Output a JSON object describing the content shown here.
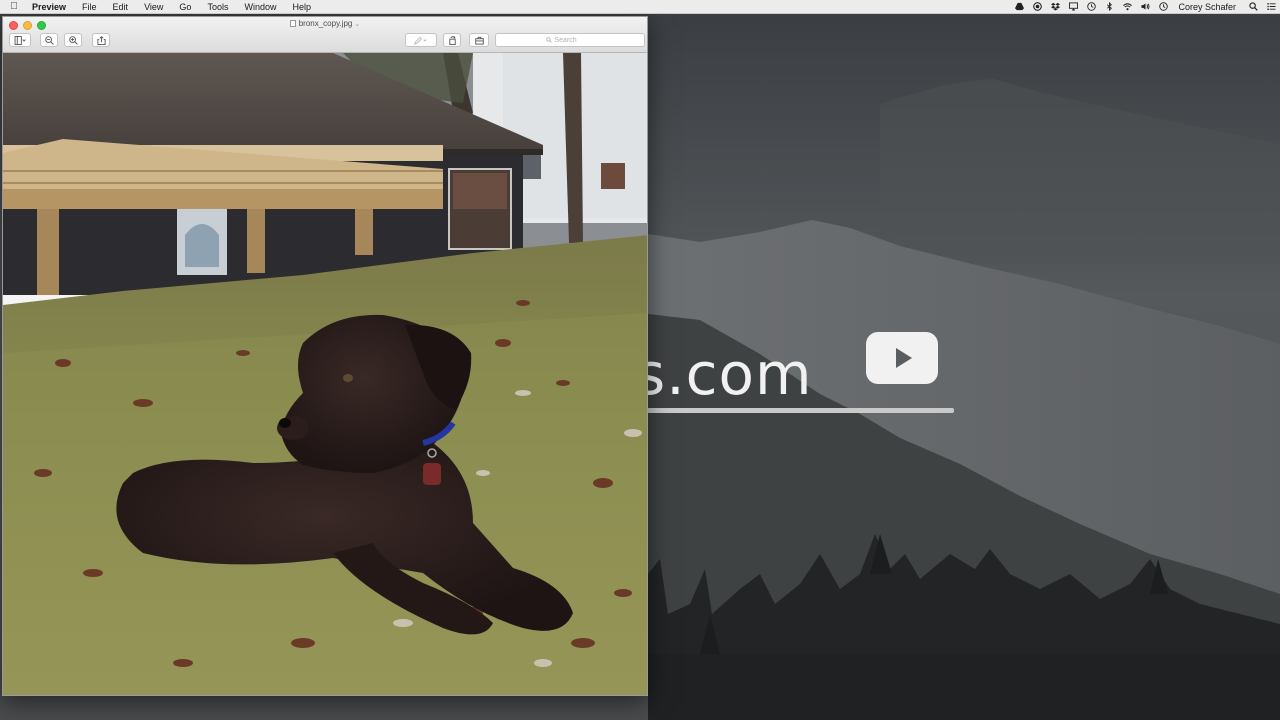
{
  "menubar": {
    "apple_icon": "apple-logo-icon",
    "app_name": "Preview",
    "menus": [
      "File",
      "Edit",
      "View",
      "Go",
      "Tools",
      "Window",
      "Help"
    ],
    "user_name": "Corey Schafer",
    "status_icons": [
      "google-drive-icon",
      "record-icon",
      "dropbox-icon",
      "airplay-display-icon",
      "time-machine-icon",
      "bluetooth-icon",
      "wifi-icon",
      "volume-icon",
      "clock-icon"
    ]
  },
  "window": {
    "title": "bronx_copy.jpg",
    "search_placeholder": "Search",
    "toolbar_icons": [
      "sidebar-toggle-icon",
      "zoom-out-icon",
      "zoom-in-icon",
      "share-icon",
      "markup-pen-icon",
      "rotate-icon",
      "toolbox-icon"
    ]
  },
  "wallpaper": {
    "logo_text": "s.com",
    "logo_icon": "play-button-icon"
  },
  "colors": {
    "menubar_bg": "#ececec",
    "close": "#fc605c",
    "minimize": "#fdbc40",
    "maximize": "#34c84a",
    "wallpaper_haze": "#6f7376"
  }
}
